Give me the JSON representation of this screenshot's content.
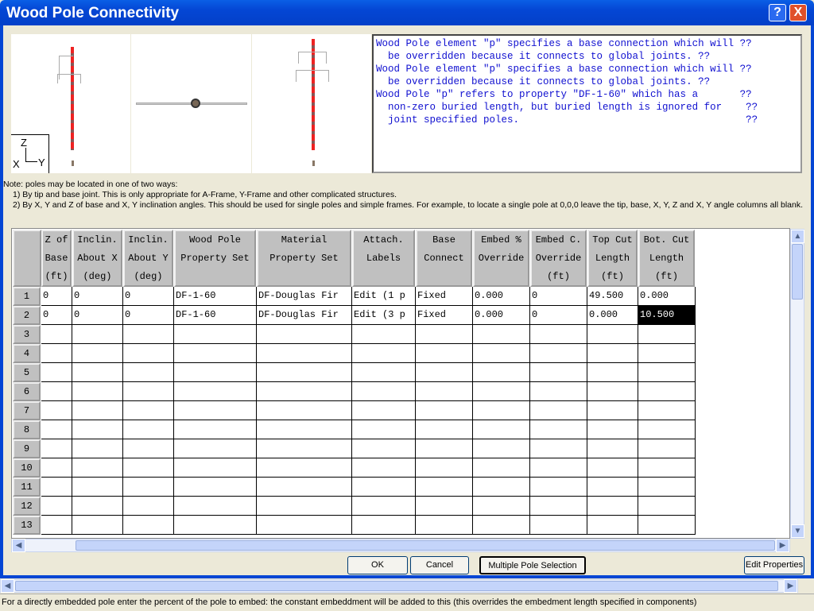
{
  "window": {
    "title": "Wood Pole Connectivity",
    "help_icon": "?",
    "close_icon": "X"
  },
  "preview": {
    "axes": {
      "z": "Z",
      "x": "X",
      "y": "Y"
    }
  },
  "messages": [
    "Wood Pole element \"p\" specifies a base connection which will ??",
    "  be overridden because it connects to global joints. ??",
    "Wood Pole element \"p\" specifies a base connection which will ??",
    "  be overridden because it connects to global joints. ??",
    "Wood Pole \"p\" refers to property \"DF-1-60\" which has a       ??",
    "  non-zero buried length, but buried length is ignored for    ??",
    "  joint specified poles.                                      ??"
  ],
  "note": {
    "line1": "Note: poles may be located in one of two ways:",
    "line2": "1) By tip and base joint.  This is only appropriate for A-Frame, Y-Frame and other complicated structures.",
    "line3": "2) By X, Y and Z of base and X, Y inclination angles.  This should be used for single poles and simple frames.  For example, to locate a single pole at 0,0,0 leave the tip, base, X, Y, Z and X, Y angle columns all blank."
  },
  "grid": {
    "columns": [
      "Z of\nBase\n(ft)",
      "Inclin.\nAbout X\n(deg)",
      "Inclin.\nAbout Y\n(deg)",
      "Wood Pole\nProperty Set",
      "Material\nProperty Set",
      "Attach.\nLabels",
      "Base\nConnect",
      "Embed %\nOverride",
      "Embed C.\nOverride\n(ft)",
      "Top Cut\nLength\n(ft)",
      "Bot. Cut\nLength\n(ft)"
    ],
    "row_numbers": [
      "1",
      "2",
      "3",
      "4",
      "5",
      "6",
      "7",
      "8",
      "9",
      "10",
      "11",
      "12",
      "13"
    ],
    "rows": [
      [
        "0",
        "0",
        "0",
        "DF-1-60",
        "DF-Douglas Fir",
        "Edit (1 p",
        "Fixed",
        "0.000",
        "0",
        "49.500",
        "0.000"
      ],
      [
        "0",
        "0",
        "0",
        "DF-1-60",
        "DF-Douglas Fir",
        "Edit (3 p",
        "Fixed",
        "0.000",
        "0",
        "0.000",
        "10.500"
      ]
    ],
    "selected_cell": {
      "row": 2,
      "column": "Bot. Cut Length"
    }
  },
  "buttons": {
    "ok": "OK",
    "cancel": "Cancel",
    "multiple": "Multiple Pole Selection",
    "edit_properties": "Edit Properties"
  },
  "status": "For a directly embedded pole enter the percent of the pole to embed: the constant embeddment will be added to this (this overrides the embedment length specified in components)",
  "colors": {
    "titlebar": "#0446d4",
    "message_text": "#1010d0",
    "pole": "#e22222",
    "selection": "#000000"
  }
}
